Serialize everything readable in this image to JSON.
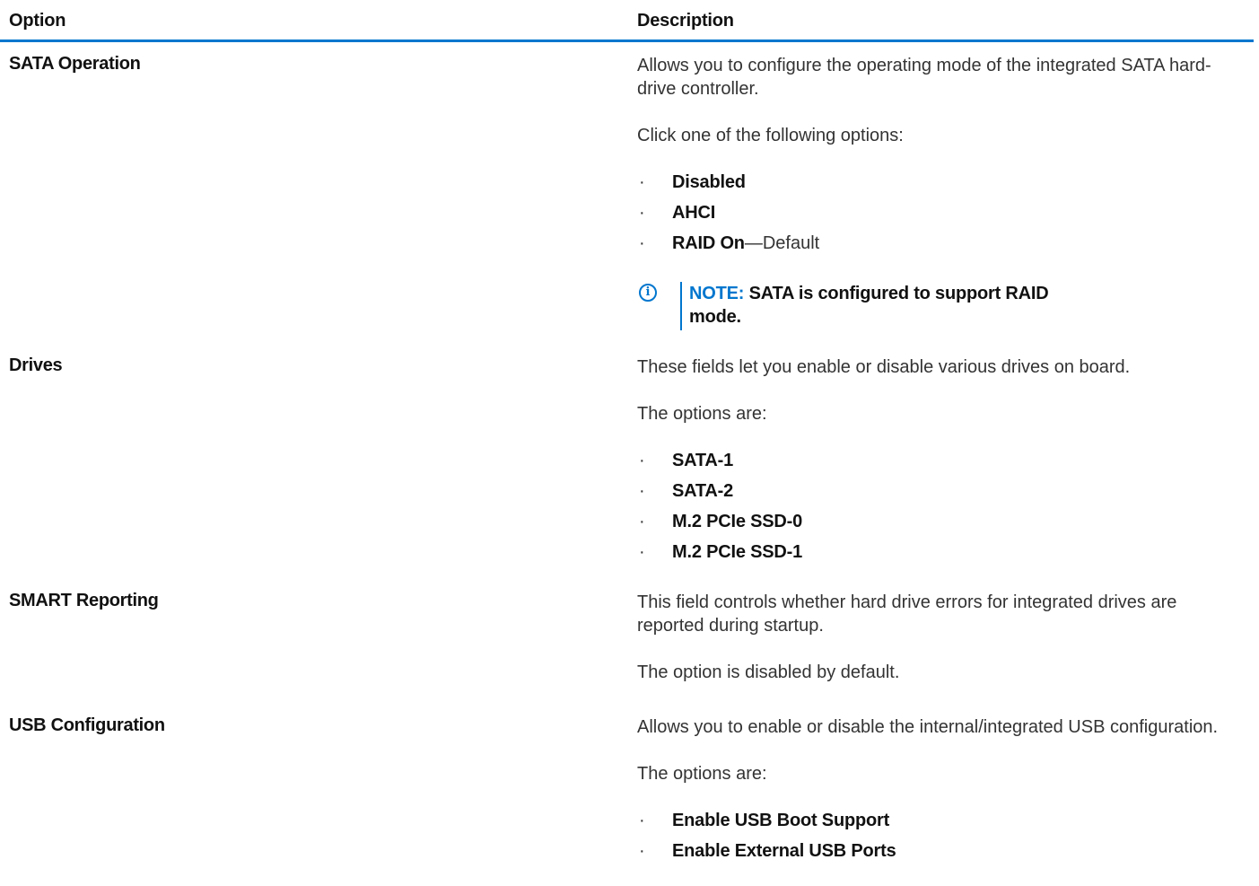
{
  "header": {
    "option_label": "Option",
    "description_label": "Description"
  },
  "colors": {
    "accent": "#0076ce",
    "text": "#111111"
  },
  "rows": [
    {
      "option": "SATA Operation",
      "paragraphs": [
        "Allows you to configure the operating mode of the integrated SATA hard-drive controller.",
        "Click one of the following options:"
      ],
      "items": [
        {
          "bold": "Disabled",
          "suffix": ""
        },
        {
          "bold": "AHCI",
          "suffix": ""
        },
        {
          "bold": "RAID On",
          "suffix": "—Default"
        }
      ],
      "note": {
        "icon": "info-icon",
        "label": "NOTE:",
        "text": "SATA is configured to support RAID mode."
      }
    },
    {
      "option": "Drives",
      "paragraphs": [
        "These fields let you enable or disable various drives on board.",
        "The options are:"
      ],
      "items": [
        {
          "bold": "SATA-1"
        },
        {
          "bold": "SATA-2"
        },
        {
          "bold": "M.2 PCIe SSD-0"
        },
        {
          "bold": "M.2 PCIe SSD-1"
        }
      ]
    },
    {
      "option": "SMART Reporting",
      "paragraphs": [
        "This field controls whether hard drive errors for integrated drives are reported during startup.",
        "The option is disabled by default."
      ]
    },
    {
      "option": "USB Configuration",
      "paragraphs": [
        "Allows you to enable or disable the internal/integrated USB configuration.",
        "The options are:"
      ],
      "items": [
        {
          "bold": "Enable USB Boot Support"
        },
        {
          "bold": "Enable External USB Ports"
        }
      ]
    }
  ]
}
